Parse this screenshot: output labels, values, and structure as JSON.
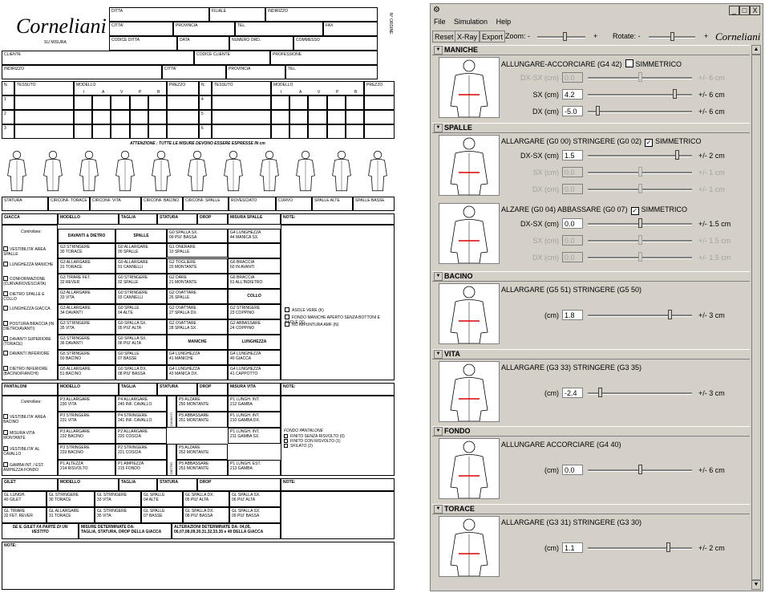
{
  "form": {
    "logo": "Corneliani",
    "logo_sub": "SU MISURA",
    "header_cells": [
      "DITTA",
      "FILIALE",
      "INDIRIZZO",
      "CITTA'",
      "PROVINCIA",
      "TEL.",
      "FAX",
      "CODICE DITTA",
      "DATA",
      "NUMERO ORD.",
      "COMMESSO",
      "CLIENTE",
      "CODICE CLIENTE",
      "PROFESSIONE",
      "INDIRIZZO",
      "CITTA'",
      "PROVINCIA",
      "TEL."
    ],
    "ordine_label": "N° ORDINE",
    "order_headers": [
      "N.",
      "TESSUTO",
      "MODELLO",
      "PREZZO",
      "N.",
      "TESSUTO",
      "MODELLO",
      "PREZZO"
    ],
    "modello_sub": [
      "I",
      "A",
      "V",
      "P",
      "B"
    ],
    "order_rows": [
      "1",
      "2",
      "3",
      "4",
      "5",
      "6"
    ],
    "warning": "ATTENZIONE : TUTTE LE MISURE DEVONO ESSERE ESPRESSE IN cm",
    "status_row": [
      "STATURA",
      "CIRCONF. TORACE",
      "CIRCONF. VITA",
      "CIRCONF. BACINO",
      "CIRCONF. SPALLE",
      "ROVESCIATO",
      "CURVO",
      "SPALLE ALTE",
      "SPALLE BASSE"
    ],
    "giacca": {
      "headers": [
        "GIACCA",
        "MODELLO",
        "TAGLIA",
        "STATURA",
        "DROP",
        "MISURA SPALLE",
        "NOTE:"
      ],
      "controllare": "Controllare:",
      "checks": [
        "VESTIBILITA' AREA SPALLE",
        "LUNGHEZZA MANICHE",
        "CONFORMAZIONE (CURVA/ROVESCIATA)",
        "DIETRO SPALLE E COLLO",
        "LUNGHEZZA GIACCA",
        "POSTURA BRACCIA (IN DIETRO/AVANTI)",
        "DAVANTI SUPERIORE (TORACE)",
        "DAVANTI INFERIORE",
        "DIETRO INFERIORE (BACINO/FIANCHI)"
      ],
      "col_davanti": "DAVANTI & DIETRO",
      "col_spalle": "SPALLE",
      "col_maniche": "MANICHE",
      "col_collo": "COLLO",
      "col_lunghezza": "LUNGHEZZA",
      "c1": [
        "G3 STRINGERE\n30 TORACE",
        "G3 ALLARGARE\n31 TORACE",
        "G3 TIRARE FET.\n32 REVER",
        "G3 ALLARGARE\n33 VITA",
        "G3 ALLARGARE\n34 DAVANTI",
        "G3 STRINGERE\n35 VITA",
        "G3 STRINGERE\n36 DAVANTI",
        "G5 STRINGERE\n50 BACINO",
        "G5 ALLARGARE\n51 BACINO"
      ],
      "c2": [
        "G0 ALLARGARE\n00 SPALLE",
        "G0 ALLARGARE\n01 CANNELLI",
        "G0 STRINGERE\n02 SPALLE",
        "G0 STRINGERE\n03 CANNELLI",
        "G0 SPALLE\n04 ALTE",
        "G0 SPALLA SX.\n05 PIU' ALTA",
        "G0 SPALLA SX.\n06 PIU' ALTA",
        "G0 SPALLE\n07 BASSE",
        "G0 SPALLA DX.\n08 PIU' BASSA"
      ],
      "c3": [
        "G0 SPALLA SX.\n09 PIU' BASSA",
        "G1 ONERARE\n10 SPALLE",
        "G2 TOGLIERE\n20 MONTANTE",
        "G2 DARE\n21 MONTANTE",
        "G2 OVATTARE\n26 SPALLE",
        "G2 OVATTARE\n27 SPALLA DX.",
        "G2 OVATTARE\n28 SPALLA SX.",
        "G4 LUNGHEZZA\n41 MANICHE",
        "G4 LUNGHEZZA\n43 MANICA DX."
      ],
      "c4": [
        "G4 LUNGHEZZA\n44 MANICA SX.",
        "G6 BRACCIA\n60 IN AVANTI",
        "G6 BRACCIA\n61 ALL'INDIETRO",
        "G2 STRINGERE\n23 COPPINO",
        "G2 ABBASSARE\n24 COPPINO",
        "G4 LUNGHEZZA\n40 GIACCA",
        "G4 LUNGHEZZA\n41 CAPPOTTO"
      ],
      "notes": [
        "ASOLE VERE (K)",
        "FONDO MANICHE APERTO SENZA BOTTONI E ASOLE (X)",
        "NO IMPUNTURA AMF (N)"
      ]
    },
    "pantaloni": {
      "headers": [
        "PANTALONI",
        "MODELLO",
        "TAGLIA",
        "STATURA",
        "DROP",
        "MISURA VITA",
        "NOTE:"
      ],
      "controllare": "Controllare:",
      "checks": [
        "VESTIBILITA' AREA BACINO",
        "MISURA VITA MONTANTE",
        "VESTIBILITA' AL CAVALLO",
        "GAMBA INT. / EST. AMPIEZZA FONDO"
      ],
      "c1": [
        "P3 ALLARGARE\n230 VITA",
        "P3 STRINGERE\n231 VITA",
        "P3 ALLARGARE\n232 BACINO",
        "P3 STRINGERE\n233 BACINO",
        "P1 ALTEZZA\n214 RISVOLTO"
      ],
      "c2": [
        "P4 ALLARGARE\n240 INF. CAVALLO",
        "P4 STRINGERE\n241 INF. CAVALLO",
        "P2 ALLARGARE\n220 COSCIA",
        "P2 STRINGERE\n221 COSCIA",
        "P1 AMPIEZZA\n215 FONDO"
      ],
      "davanti": "DAVANTI",
      "dietro": "DIETRO",
      "c3": [
        "P5 ALZARE\n250 MONTANTE",
        "P5 ABBASSARE\n251 MONTANTE",
        "P5 ALZARE\n252 MONTANTE",
        "P5 ABBASSARE\n253 MONTANTE"
      ],
      "c4": [
        "P1 LUNGH. INT.\n212 GAMBA",
        "P1 LUNGH. INT.\n210 GAMBA DX.",
        "P1 LUNGH. INT.\n211 GAMBA SX.",
        "P1 LUNGH. EST.\n213 GAMBA"
      ],
      "fondo_title": "FONDO PANTALONE",
      "fondo": [
        "FINITO SENZA RISVOLTO (0)",
        "FINITO CON RISVOLTO (1)",
        "SFILATO (2)"
      ]
    },
    "gilet": {
      "headers": [
        "GILET",
        "MODELLO",
        "TAGLIA",
        "STATURA",
        "DROP",
        "NOTE:"
      ],
      "r1": [
        "GL LUNGH.\n40 GILET",
        "GL STRINGERE\n30 TORACE",
        "GL STRINGERE\n33 VITA",
        "GL SPALLE\n04 ALTE",
        "GL SPALLA DX.\n05 PIU' ALTA",
        "GL SPALLA SX.\n06 PIU' ALTA"
      ],
      "r2": [
        "GL TIRARE\n32 FET. REVER",
        "GL ALLARGARE\n31 TORACE",
        "GL STRINGERE\n35 VITA",
        "GL SPALLE\n07 BASSE",
        "GL SPALLA DX.\n08 PIU' BASSA",
        "GL SPALLA SX.\n09 PIU' BASSA"
      ],
      "foot1": "SE IL GILET FA PARTE DI UN VESTITO",
      "foot2": "MISURE DETERMINATE DA:\nTAGLIA, STATURA, DROP DELLA GIACCA",
      "foot3": "ALTERAZIONI DETERMINATE DA: 04,05,\n06,07,08,09,30,31,32,33,35 e 40 DELLA GIACCA",
      "note": "NOTE:"
    }
  },
  "app": {
    "title_icon": "app-icon",
    "window_buttons": [
      "_",
      "□",
      "X"
    ],
    "menu": [
      "File",
      "Simulation",
      "Help"
    ],
    "toolbar": {
      "reset": "Reset",
      "xray": "X-Ray",
      "export": "Export",
      "zoom": "Zoom: -",
      "plus1": "+",
      "rotate": "Rotate: -",
      "plus2": "+",
      "brand": "Corneliani"
    },
    "sections": [
      {
        "title": "MANICHE",
        "line1": "ALLUNGARE-ACCORCIARE (G4 42)",
        "sym_label": "SIMMETRICO",
        "sym_checked": false,
        "rows": [
          {
            "label": "DX-SX (cm)",
            "value": "0.0",
            "range": "+/- 6 cm",
            "pos": 0.5,
            "disabled": true
          },
          {
            "label": "SX (cm)",
            "value": "4.2",
            "range": "+/- 6 cm",
            "pos": 0.85,
            "disabled": false
          },
          {
            "label": "DX (cm)",
            "value": "-5.0",
            "range": "+/- 6 cm",
            "pos": 0.08,
            "disabled": false
          }
        ]
      },
      {
        "title": "SPALLE",
        "line1": "ALLARGARE (G0 00) STRINGERE (G0 02)",
        "sym_label": "SIMMETRICO",
        "sym_checked": true,
        "rows": [
          {
            "label": "DX-SX (cm)",
            "value": "1.5",
            "range": "+/- 2 cm",
            "pos": 0.87,
            "disabled": false
          },
          {
            "label": "SX (cm)",
            "value": "0.0",
            "range": "+/- 1 cm",
            "pos": 0.5,
            "disabled": true
          },
          {
            "label": "DX (cm)",
            "value": "0.0",
            "range": "+/- 1 cm",
            "pos": 0.5,
            "disabled": true
          }
        ]
      },
      {
        "title": "",
        "line1": "ALZARE (G0 04) ABBASSARE (G0 07)",
        "sym_label": "SIMMETRICO",
        "sym_checked": true,
        "rows": [
          {
            "label": "DX-SX (cm)",
            "value": "0.0",
            "range": "+/- 1.5 cm",
            "pos": 0.5,
            "disabled": false
          },
          {
            "label": "SX (cm)",
            "value": "0.0",
            "range": "+/- 1.5 cm",
            "pos": 0.5,
            "disabled": true
          },
          {
            "label": "DX (cm)",
            "value": "0.0",
            "range": "+/- 1.5 cm",
            "pos": 0.5,
            "disabled": true
          }
        ]
      },
      {
        "title": "BACINO",
        "line1": "ALLARGARE (G5 51) STRINGERE (G5 50)",
        "sym_label": "",
        "sym_checked": false,
        "rows": [
          {
            "label": "(cm)",
            "value": "1.8",
            "range": "+/- 3 cm",
            "pos": 0.8,
            "disabled": false
          }
        ]
      },
      {
        "title": "VITA",
        "line1": "ALLARGARE (G3 33) STRINGERE (G3 35)",
        "sym_label": "",
        "sym_checked": false,
        "rows": [
          {
            "label": "(cm)",
            "value": "-2.4",
            "range": "+/- 3 cm",
            "pos": 0.1,
            "disabled": false
          }
        ]
      },
      {
        "title": "FONDO",
        "line1": "ALLUNGARE ACCORCIARE (G4 40)",
        "sym_label": "",
        "sym_checked": false,
        "rows": [
          {
            "label": "(cm)",
            "value": "0.0",
            "range": "+/- 6 cm",
            "pos": 0.5,
            "disabled": false
          }
        ]
      },
      {
        "title": "TORACE",
        "line1": "ALLARGARE (G3 31) STRINGERE (G3 30)",
        "sym_label": "",
        "sym_checked": false,
        "rows": [
          {
            "label": "(cm)",
            "value": "1.1",
            "range": "+/- 2 cm",
            "pos": 0.78,
            "disabled": false
          }
        ]
      }
    ]
  }
}
